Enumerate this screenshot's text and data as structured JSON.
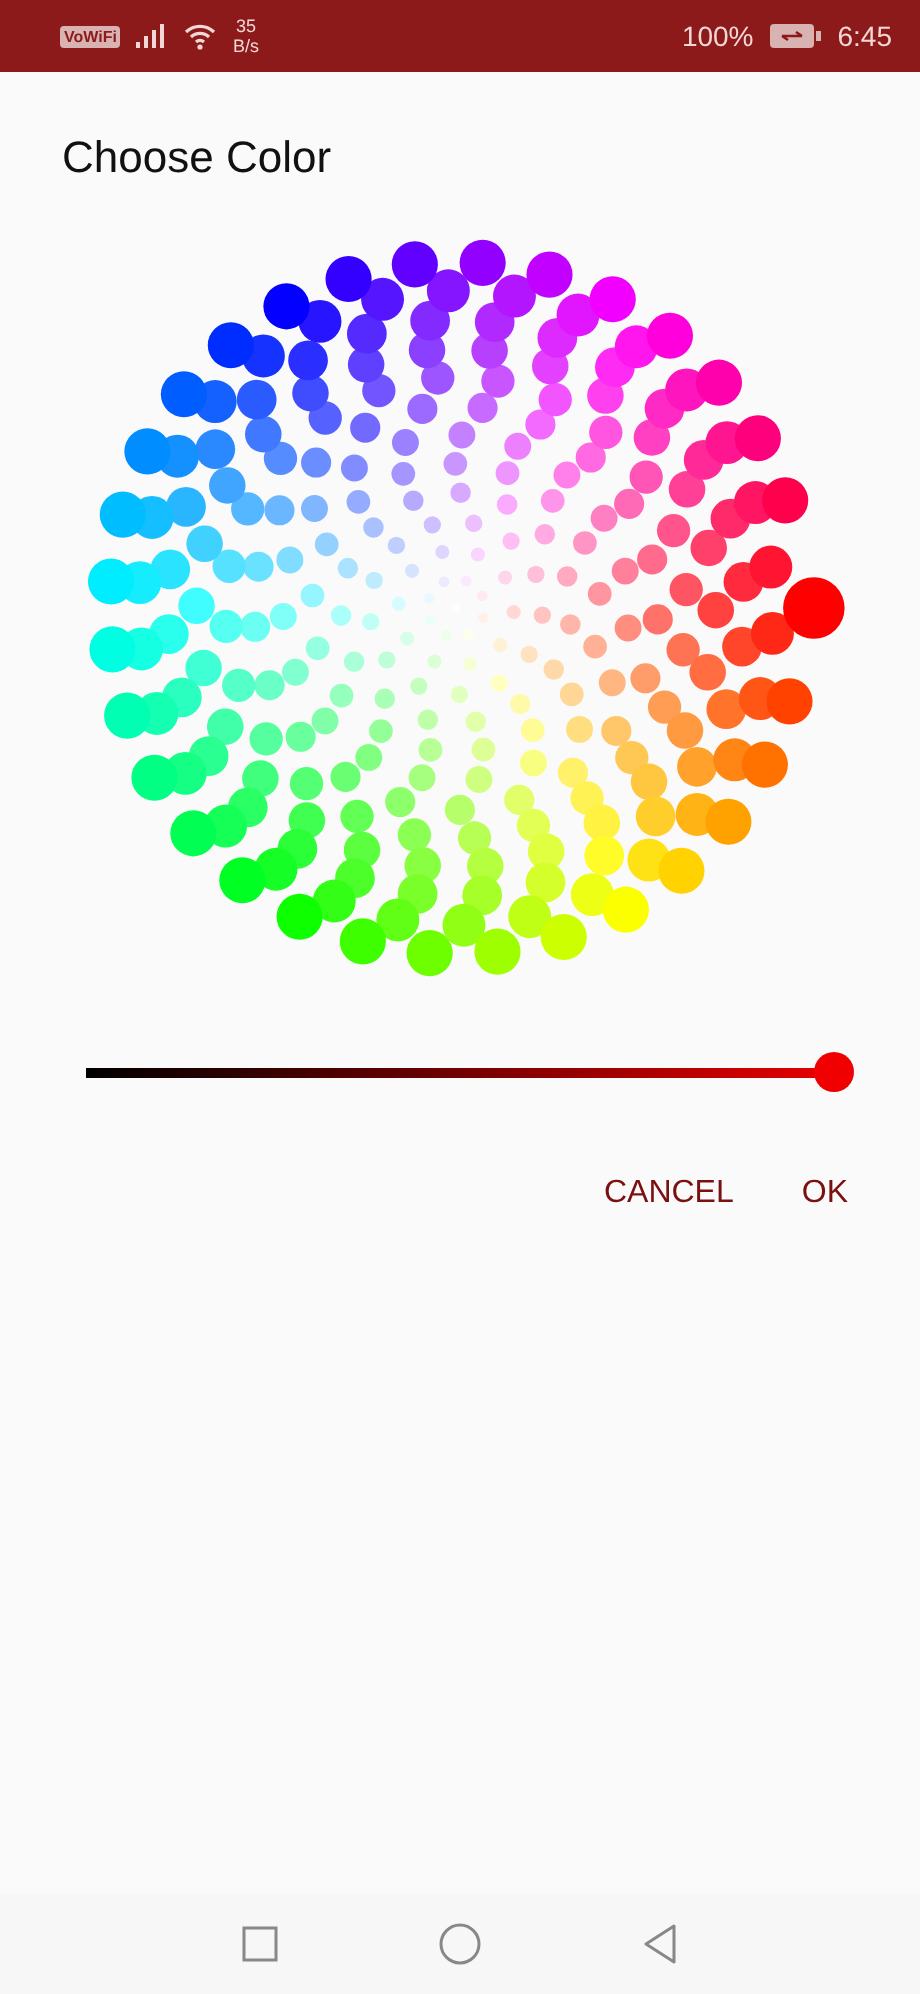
{
  "status_bar": {
    "vowifi": "VoWiFi",
    "speed_value": "35",
    "speed_unit": "B/s",
    "battery": "100%",
    "time": "6:45"
  },
  "dialog": {
    "title": "Choose Color",
    "brightness_slider": {
      "level": 1
    },
    "buttons": [
      "CANCEL",
      "OK"
    ]
  }
}
